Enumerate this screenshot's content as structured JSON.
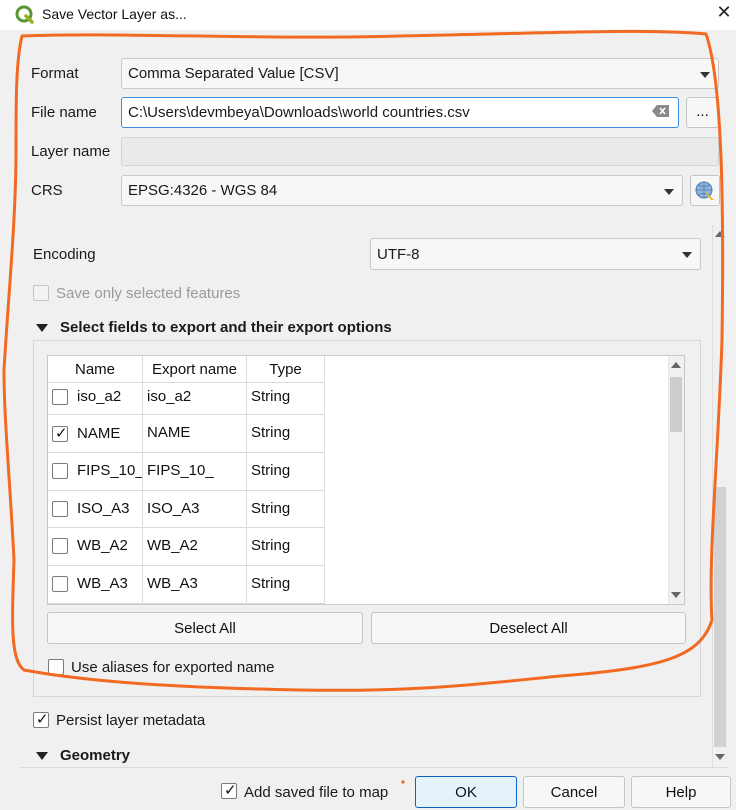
{
  "window": {
    "title": "Save Vector Layer as...",
    "app_icon": "qgis-logo-icon",
    "close_icon": "close-icon"
  },
  "form": {
    "format_label": "Format",
    "format_value": "Comma Separated Value [CSV]",
    "filename_label": "File name",
    "filename_value": "C:\\Users\\devmbeya\\Downloads\\world countries.csv",
    "browse_label": "...",
    "layername_label": "Layer name",
    "layername_value": "",
    "crs_label": "CRS",
    "crs_value": "EPSG:4326 - WGS 84",
    "encoding_label": "Encoding",
    "encoding_value": "UTF-8",
    "save_selected_label": "Save only selected features"
  },
  "fields_section": {
    "title": "Select fields to export and their export options",
    "columns": [
      "Name",
      "Export name",
      "Type"
    ],
    "rows": [
      {
        "name": "iso_a2",
        "export": "iso_a2",
        "type": "String",
        "checked": false
      },
      {
        "name": "NAME",
        "export": "NAME",
        "type": "String",
        "checked": true
      },
      {
        "name": "FIPS_10_",
        "export": "FIPS_10_",
        "type": "String",
        "checked": false
      },
      {
        "name": "ISO_A3",
        "export": "ISO_A3",
        "type": "String",
        "checked": false
      },
      {
        "name": "WB_A2",
        "export": "WB_A2",
        "type": "String",
        "checked": false
      },
      {
        "name": "WB_A3",
        "export": "WB_A3",
        "type": "String",
        "checked": false
      }
    ],
    "select_all": "Select All",
    "deselect_all": "Deselect All",
    "use_aliases": "Use aliases for exported name"
  },
  "persist_metadata": "Persist layer metadata",
  "geometry_section": "Geometry",
  "footer": {
    "add_to_map": "Add saved file to map",
    "ok": "OK",
    "cancel": "Cancel",
    "help": "Help"
  },
  "check_glyph": "✓",
  "colors": {
    "annotation": "#f26a21",
    "focus": "#3d8ee0"
  }
}
